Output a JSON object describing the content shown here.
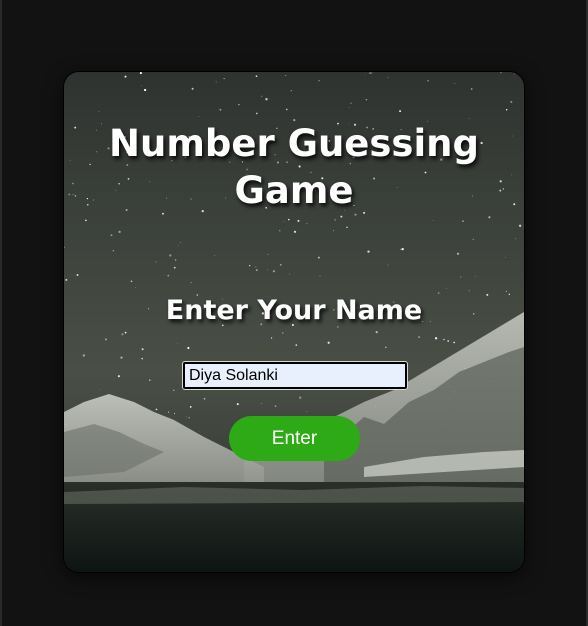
{
  "game": {
    "title": "Number Guessing Game",
    "subtitle": "Enter Your Name",
    "name_input_value": "Diya Solanki",
    "enter_label": "Enter"
  },
  "colors": {
    "page_background": "#121212",
    "button_green": "#2eaa16",
    "input_background": "#e8f0fe",
    "text_white": "#ffffff"
  }
}
